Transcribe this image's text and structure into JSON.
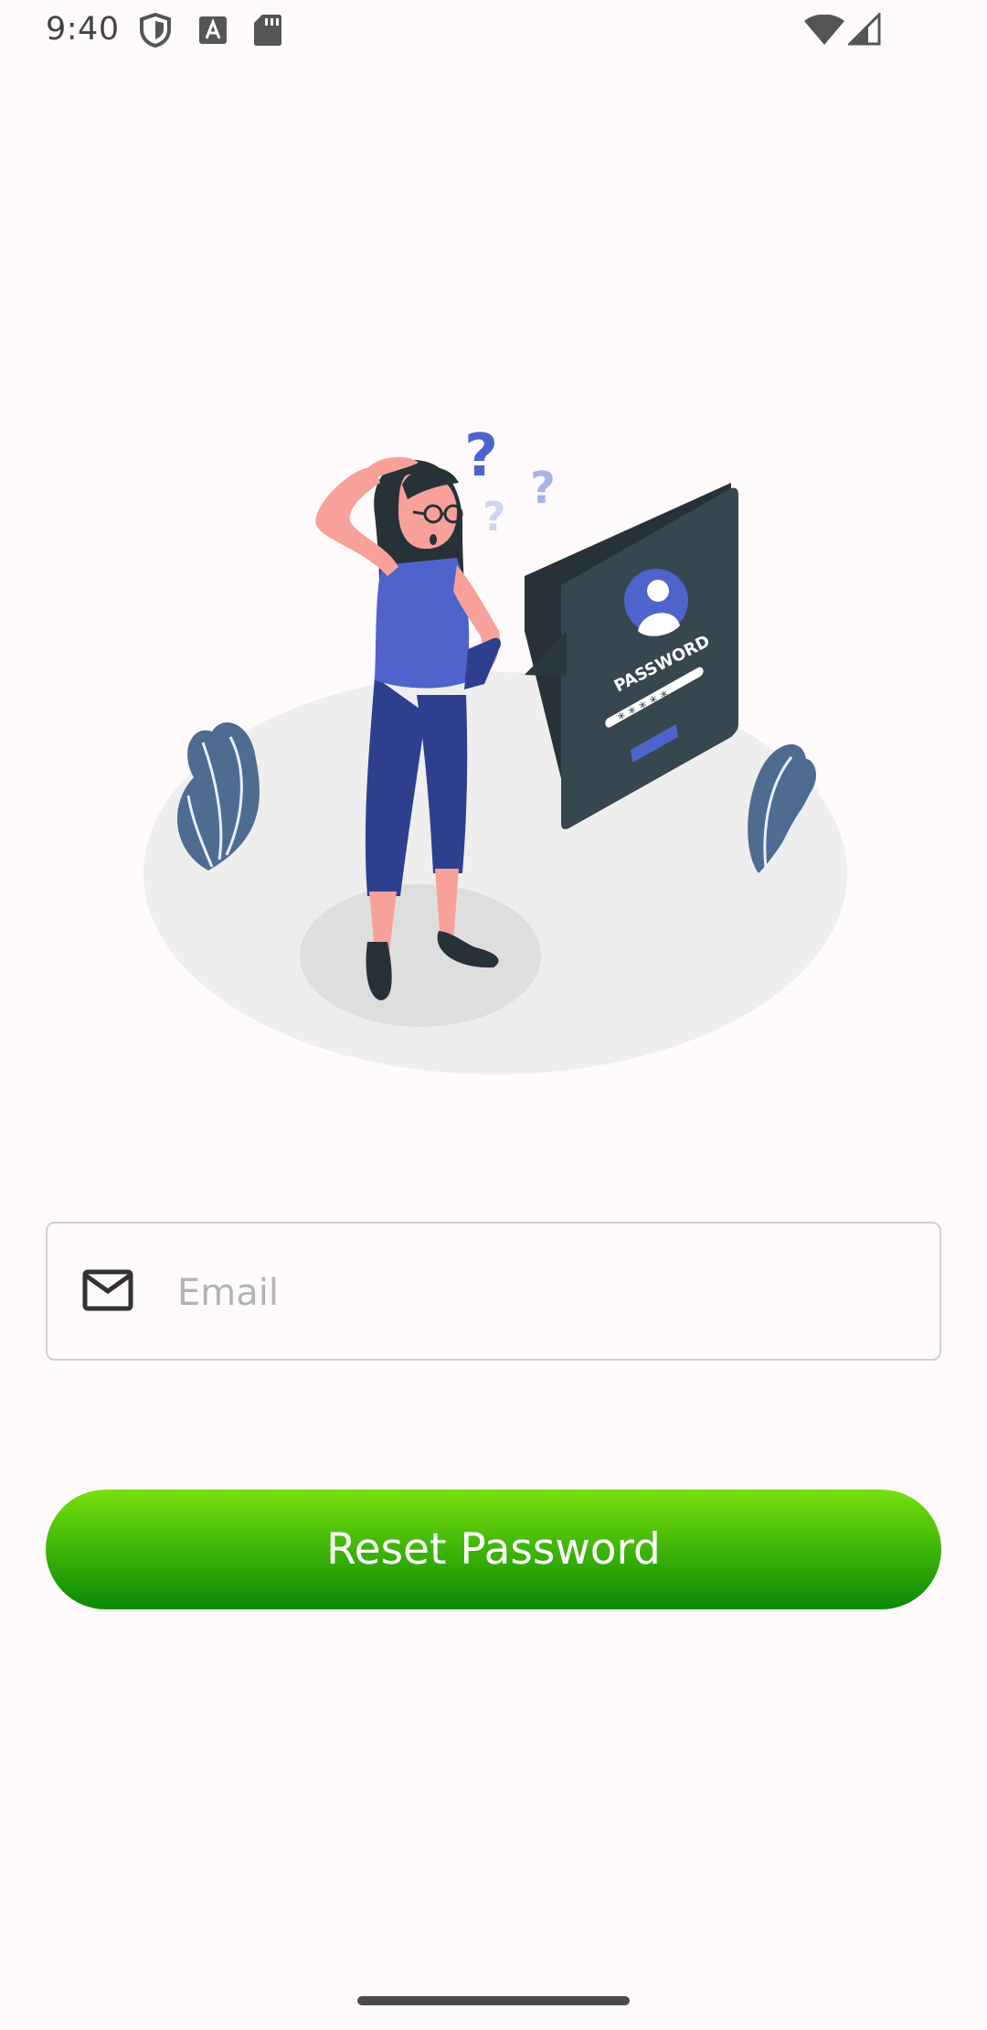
{
  "status_bar": {
    "time": "9:40",
    "icons": [
      "shield-icon",
      "font-a-icon",
      "sd-card-icon",
      "wifi-icon",
      "cellular-signal-icon"
    ]
  },
  "illustration": {
    "card_title": "PASSWORD",
    "card_dots": "* * * * *",
    "question_marks": [
      "?",
      "?",
      "?"
    ],
    "colors": {
      "accent": "#4f63cc",
      "card": "#37474f",
      "plant": "#4f6b92",
      "skin": "#f8a09a",
      "floor": "#eeeeee"
    }
  },
  "form": {
    "email_placeholder": "Email",
    "email_value": "",
    "mail_icon": "mail-icon"
  },
  "actions": {
    "reset_label": "Reset Password"
  },
  "colors": {
    "background": "#fffbfd",
    "button_gradient_top": "#77e10e",
    "button_gradient_bottom": "#0a8a06",
    "field_border": "#cfcfcf"
  }
}
